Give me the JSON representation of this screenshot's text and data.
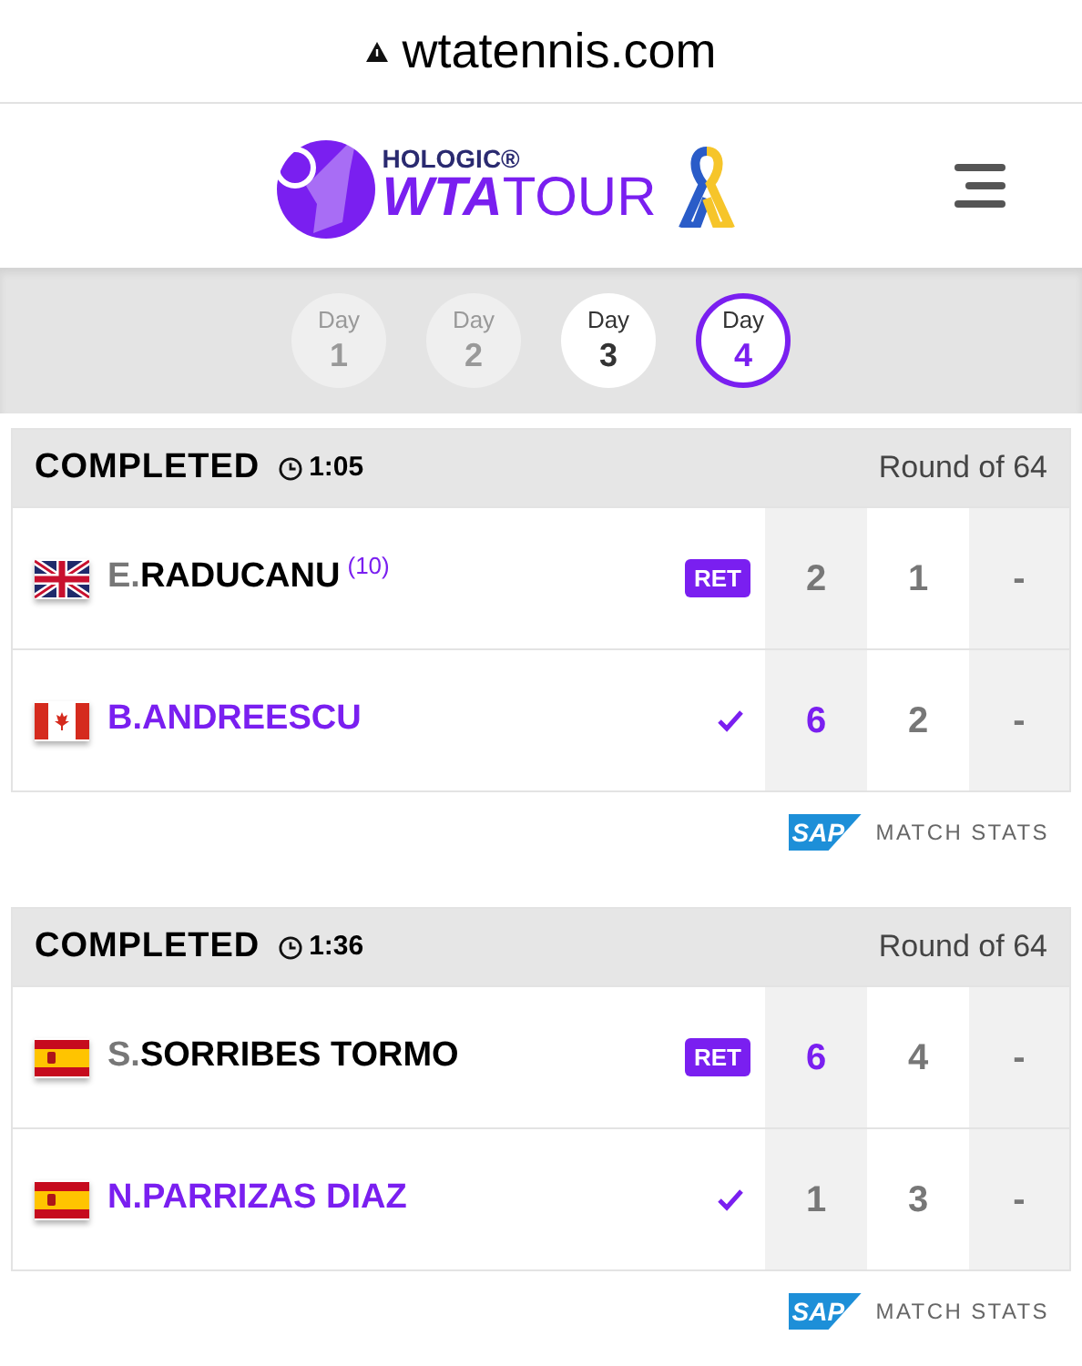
{
  "address_bar": {
    "url": "wtatennis.com"
  },
  "header": {
    "logo": {
      "sponsor": "HOLOGIC®",
      "brand": "WTA",
      "suffix": "TOUR"
    }
  },
  "days": [
    {
      "label": "Day",
      "number": "1",
      "selected": false,
      "disabled": true
    },
    {
      "label": "Day",
      "number": "2",
      "selected": false,
      "disabled": true
    },
    {
      "label": "Day",
      "number": "3",
      "selected": false,
      "disabled": false
    },
    {
      "label": "Day",
      "number": "4",
      "selected": true,
      "disabled": false
    }
  ],
  "matches": [
    {
      "status": "COMPLETED",
      "duration": "1:05",
      "round": "Round of 64",
      "players": [
        {
          "flag": {
            "kind": "gb"
          },
          "initial": "E.",
          "surname": "RADUCANU",
          "seed": "(10)",
          "winner": false,
          "badge": "RET",
          "scores": [
            {
              "value": "2",
              "won": false
            },
            {
              "value": "1",
              "won": false
            },
            {
              "value": "-",
              "won": false
            }
          ]
        },
        {
          "flag": {
            "kind": "ca"
          },
          "initial": "B.",
          "surname": "ANDREESCU",
          "winner": true,
          "scores": [
            {
              "value": "6",
              "won": true
            },
            {
              "value": "2",
              "won": false
            },
            {
              "value": "-",
              "won": false
            }
          ]
        }
      ],
      "stats_link": {
        "sponsor": "SAP",
        "label": "MATCH STATS"
      }
    },
    {
      "status": "COMPLETED",
      "duration": "1:36",
      "round": "Round of 64",
      "players": [
        {
          "flag": {
            "kind": "es"
          },
          "initial": "S.",
          "surname": "SORRIBES TORMO",
          "winner": false,
          "badge": "RET",
          "scores": [
            {
              "value": "6",
              "won": true
            },
            {
              "value": "4",
              "won": false
            },
            {
              "value": "-",
              "won": false
            }
          ]
        },
        {
          "flag": {
            "kind": "es"
          },
          "initial": "N.",
          "surname": "PARRIZAS DIAZ",
          "winner": true,
          "scores": [
            {
              "value": "1",
              "won": false
            },
            {
              "value": "3",
              "won": false
            },
            {
              "value": "-",
              "won": false
            }
          ]
        }
      ],
      "stats_link": {
        "sponsor": "SAP",
        "label": "MATCH STATS"
      }
    }
  ]
}
